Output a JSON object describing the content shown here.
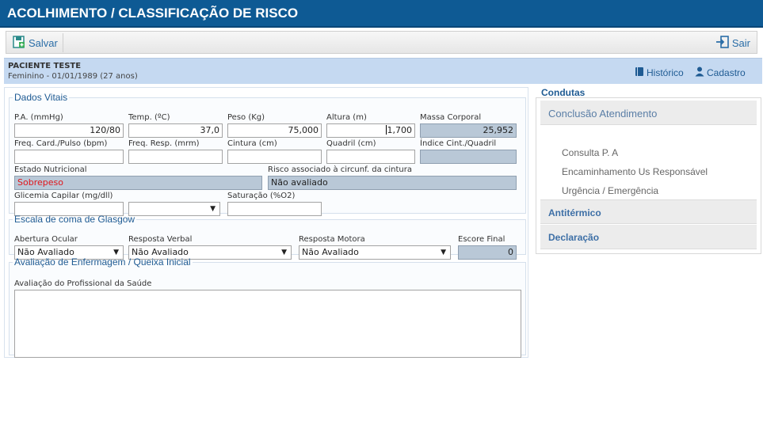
{
  "header": {
    "title": "ACOLHIMENTO / CLASSIFICAÇÃO DE RISCO"
  },
  "toolbar": {
    "save_label": "Salvar",
    "exit_label": "Sair"
  },
  "patient": {
    "name": "PACIENTE TESTE",
    "info": "Feminino - 01/01/1989 (27 anos)",
    "history_label": "Histórico",
    "register_label": "Cadastro"
  },
  "vitals": {
    "legend": "Dados Vitais",
    "pa_label": "P.A. (mmHg)",
    "pa_value": "120/80",
    "temp_label": "Temp. (ºC)",
    "temp_value": "37,0",
    "peso_label": "Peso (Kg)",
    "peso_value": "75,000",
    "altura_label": "Altura (m)",
    "altura_value": "1,700",
    "massa_label": "Massa Corporal",
    "massa_value": "25,952",
    "freq_card_label": "Freq. Card./Pulso (bpm)",
    "freq_card_value": "",
    "freq_resp_label": "Freq. Resp. (mrm)",
    "freq_resp_value": "",
    "cintura_label": "Cintura (cm)",
    "cintura_value": "",
    "quadril_label": "Quadril (cm)",
    "quadril_value": "",
    "indice_label": "Índice Cint./Quadril",
    "indice_value": "",
    "estado_label": "Estado Nutricional",
    "estado_value": "Sobrepeso",
    "risco_label": "Risco associado à circunf. da cintura",
    "risco_value": "Não avaliado",
    "glicemia_label": "Glicemia Capilar (mg/dll)",
    "glicemia_value": "",
    "glicemia_select": "",
    "saturacao_label": "Saturação (%O2)",
    "saturacao_value": ""
  },
  "glasgow": {
    "legend": "Escala de coma de Glasgow",
    "ocular_label": "Abertura Ocular",
    "ocular_value": "Não Avaliado",
    "verbal_label": "Resposta Verbal",
    "verbal_value": "Não Avaliado",
    "motora_label": "Resposta Motora",
    "motora_value": "Não Avaliado",
    "escore_label": "Escore Final",
    "escore_value": "0"
  },
  "nursing": {
    "legend": "Avaliação de Enfermagem / Queixa Inicial",
    "label": "Avaliação do Profissional da Saúde",
    "value": ""
  },
  "condutas": {
    "title": "Condutas",
    "sections": [
      {
        "label": "Conclusão Atendimento",
        "items": [
          "Consulta P. A",
          "Encaminhamento Us Responsável",
          "Urgência / Emergência"
        ]
      },
      {
        "label": "Antitérmico"
      },
      {
        "label": "Declaração"
      }
    ]
  },
  "icons": {
    "save": "save-icon",
    "exit": "exit-icon",
    "history": "book-icon",
    "register": "user-icon"
  },
  "colors": {
    "header_bg": "#0e5a94",
    "patient_bg": "#c5d9f1",
    "readonly_bg": "#b9c8d7",
    "alert_text": "#e0161c"
  }
}
